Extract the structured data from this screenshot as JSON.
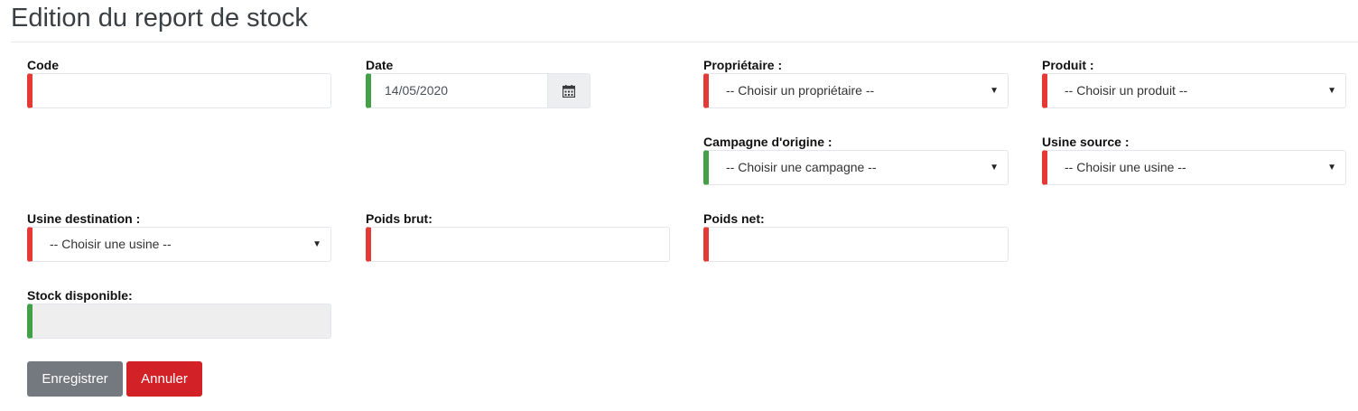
{
  "page": {
    "title": "Edition du report de stock"
  },
  "form": {
    "code": {
      "label": "Code",
      "value": ""
    },
    "date": {
      "label": "Date",
      "value": "14/05/2020",
      "icon": "calendar-icon"
    },
    "proprietaire": {
      "label": "Propriétaire :",
      "selected": "-- Choisir un propriétaire --"
    },
    "produit": {
      "label": "Produit :",
      "selected": "-- Choisir un produit --"
    },
    "campagne": {
      "label": "Campagne d'origine :",
      "selected": "-- Choisir une campagne --"
    },
    "usine_source": {
      "label": "Usine source :",
      "selected": "-- Choisir une usine --"
    },
    "usine_destination": {
      "label": "Usine destination :",
      "selected": "-- Choisir une usine --"
    },
    "poids_brut": {
      "label": "Poids brut:",
      "value": ""
    },
    "poids_net": {
      "label": "Poids net:",
      "value": ""
    },
    "stock_disponible": {
      "label": "Stock disponible:",
      "value": ""
    }
  },
  "actions": {
    "save_label": "Enregistrer",
    "cancel_label": "Annuler"
  },
  "colors": {
    "required_bar": "#e53935",
    "valid_bar": "#43a047",
    "save_button": "#747980",
    "cancel_button": "#d32128"
  }
}
